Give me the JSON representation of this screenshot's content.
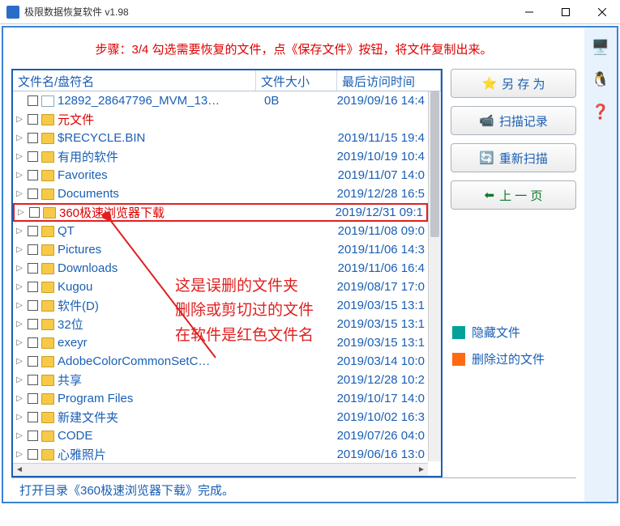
{
  "window": {
    "title": "极限数据恢复软件 v1.98"
  },
  "instruction": "步骤：3/4 勾选需要恢复的文件，点《保存文件》按钮，将文件复制出来。",
  "columns": {
    "name": "文件名/盘符名",
    "size": "文件大小",
    "date": "最后访问时间"
  },
  "files": [
    {
      "name": "12892_28647796_MVM_13…",
      "size": "0B",
      "date": "2019/09/16 14:4",
      "type": "file",
      "red": false
    },
    {
      "name": "元文件",
      "size": "",
      "date": "",
      "type": "folder",
      "red": true
    },
    {
      "name": "$RECYCLE.BIN",
      "size": "",
      "date": "2019/11/15 19:4",
      "type": "folder",
      "red": false
    },
    {
      "name": "有用的软件",
      "size": "",
      "date": "2019/10/19 10:4",
      "type": "folder",
      "red": false
    },
    {
      "name": "Favorites",
      "size": "",
      "date": "2019/11/07 14:0",
      "type": "folder",
      "red": false
    },
    {
      "name": "Documents",
      "size": "",
      "date": "2019/12/28 16:5",
      "type": "folder",
      "red": false
    },
    {
      "name": "360极速浏览器下载",
      "size": "",
      "date": "2019/12/31 09:1",
      "type": "folder",
      "red": true,
      "hl": true
    },
    {
      "name": "QT",
      "size": "",
      "date": "2019/11/08 09:0",
      "type": "folder",
      "red": false
    },
    {
      "name": "Pictures",
      "size": "",
      "date": "2019/11/06 14:3",
      "type": "folder",
      "red": false
    },
    {
      "name": "Downloads",
      "size": "",
      "date": "2019/11/06 16:4",
      "type": "folder",
      "red": false
    },
    {
      "name": "Kugou",
      "size": "",
      "date": "2019/08/17 17:0",
      "type": "folder",
      "red": false
    },
    {
      "name": "软件(D)",
      "size": "",
      "date": "2019/03/15 13:1",
      "type": "folder",
      "red": false
    },
    {
      "name": "32位",
      "size": "",
      "date": "2019/03/15 13:1",
      "type": "folder",
      "red": false
    },
    {
      "name": "exeyr",
      "size": "",
      "date": "2019/03/15 13:1",
      "type": "folder",
      "red": false
    },
    {
      "name": "AdobeColorCommonSetC…",
      "size": "",
      "date": "2019/03/14 10:0",
      "type": "folder",
      "red": false
    },
    {
      "name": "共享",
      "size": "",
      "date": "2019/12/28 10:2",
      "type": "folder",
      "red": false
    },
    {
      "name": "Program Files",
      "size": "",
      "date": "2019/10/17 14:0",
      "type": "folder",
      "red": false
    },
    {
      "name": "新建文件夹",
      "size": "",
      "date": "2019/10/02 16:3",
      "type": "folder",
      "red": false
    },
    {
      "name": "CODE",
      "size": "",
      "date": "2019/07/26 04:0",
      "type": "folder",
      "red": false
    },
    {
      "name": "心雅照片",
      "size": "",
      "date": "2019/06/16 13:0",
      "type": "folder",
      "red": false
    }
  ],
  "buttons": {
    "save": "另 存 为",
    "scanlog": "扫描记录",
    "rescan": "重新扫描",
    "prev": "上 一 页"
  },
  "legend": {
    "hidden_label": "隐藏文件",
    "hidden_color": "#00a29a",
    "deleted_label": "删除过的文件",
    "deleted_color": "#ff6a13"
  },
  "annotation": {
    "l1": "这是误删的文件夹",
    "l2": "删除或剪切过的文件",
    "l3": "在软件是红色文件名"
  },
  "status": "打开目录《360极速浏览器下载》完成。"
}
